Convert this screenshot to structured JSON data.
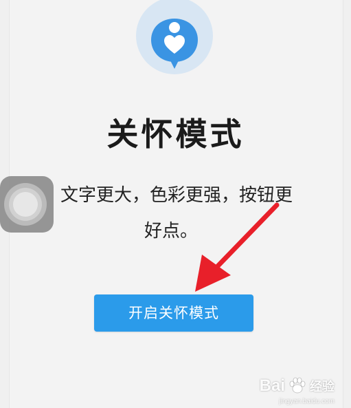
{
  "page": {
    "title": "关怀模式",
    "description_line1": "文字更大，色彩更强，按钮更",
    "description_line2": "好点。",
    "button_label": "开启关怀模式"
  },
  "watermark": {
    "brand": "Bai",
    "product": "经验",
    "url": "jingyan.baidu.com"
  },
  "colors": {
    "accent": "#2b9bea",
    "arrow": "#e8202a",
    "background": "#f3f3f3",
    "logo_outer": "#d8e6f3",
    "logo_inner": "#3a94e3"
  }
}
